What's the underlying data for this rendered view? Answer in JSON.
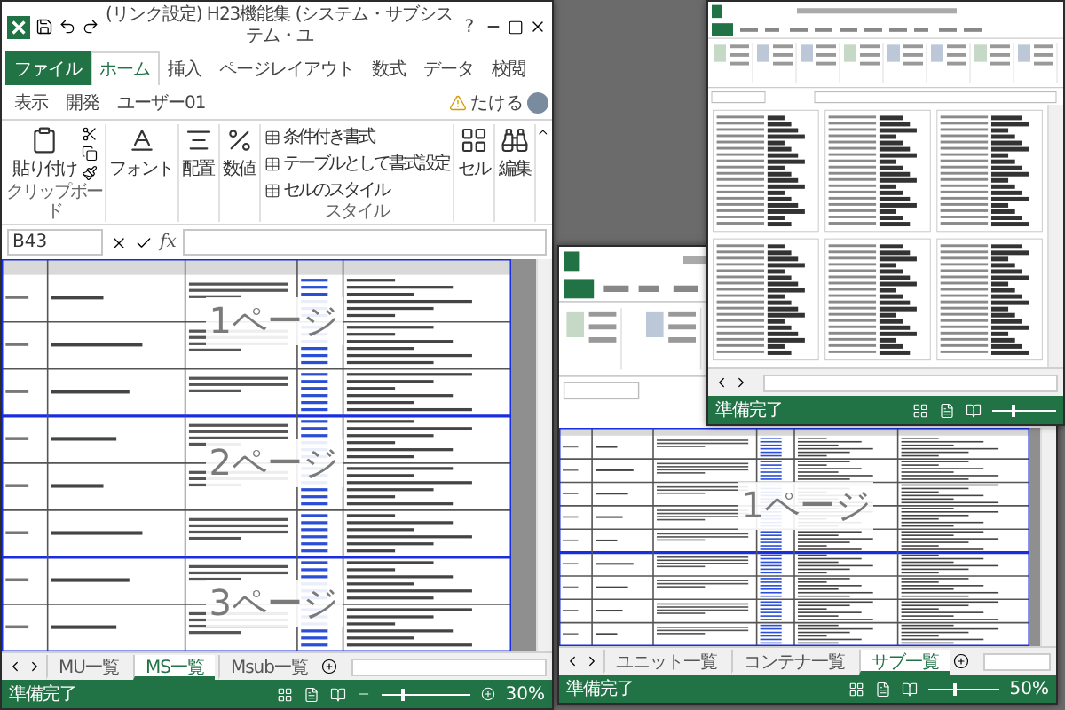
{
  "main_window": {
    "title": "(リンク設定) H23機能集 (システム・サブシステム・ユ",
    "help": "?",
    "menu_tabs": [
      {
        "label": "ファイル",
        "kind": "file",
        "selected": false
      },
      {
        "label": "ホーム",
        "kind": "tab",
        "selected": true
      },
      {
        "label": "挿入",
        "kind": "tab",
        "selected": false
      },
      {
        "label": "ページレイアウト",
        "kind": "tab",
        "selected": false
      },
      {
        "label": "数式",
        "kind": "tab",
        "selected": false
      },
      {
        "label": "データ",
        "kind": "tab",
        "selected": false
      },
      {
        "label": "校閲",
        "kind": "tab",
        "selected": false
      },
      {
        "label": "表示",
        "kind": "tab",
        "selected": false
      },
      {
        "label": "開発",
        "kind": "tab",
        "selected": false
      },
      {
        "label": "ユーザー01",
        "kind": "tab",
        "selected": false
      }
    ],
    "account": "たける",
    "ribbon": [
      {
        "kind": "clipboard",
        "label": "貼り付け",
        "group": "クリップボード"
      },
      {
        "kind": "large",
        "label": "フォント"
      },
      {
        "kind": "large",
        "label": "配置"
      },
      {
        "kind": "large",
        "label": "数値"
      },
      {
        "kind": "list",
        "items": [
          "条件付き書式",
          "テーブルとして書式設定",
          "セルのスタイル"
        ],
        "group": "スタイル"
      },
      {
        "kind": "large",
        "label": "セル"
      },
      {
        "kind": "large",
        "label": "編集"
      }
    ],
    "name_box": "B43",
    "function_label": "fx",
    "page_labels": [
      "1ページ",
      "2ページ",
      "3ページ"
    ],
    "sheet_tabs": [
      {
        "label": "MU一覧",
        "selected": false
      },
      {
        "label": "MS一覧",
        "selected": true
      },
      {
        "label": "Msub一覧",
        "selected": false
      }
    ],
    "status": "準備完了",
    "zoom": "30%",
    "zoom_slider": {
      "level": 0.22
    }
  },
  "back_window": {
    "page_labels": [
      "1ページ"
    ],
    "sheet_tabs": [
      {
        "label": "ユニット一覧",
        "selected": false
      },
      {
        "label": "コンテナ一覧",
        "selected": false
      },
      {
        "label": "サブ一覧",
        "selected": true
      }
    ],
    "status": "準備完了",
    "zoom": "50%",
    "zoom_slider": {
      "level": 0.35
    }
  },
  "front_window": {
    "status": "準備完了",
    "zoom_slider": {
      "level": 0.3
    }
  }
}
